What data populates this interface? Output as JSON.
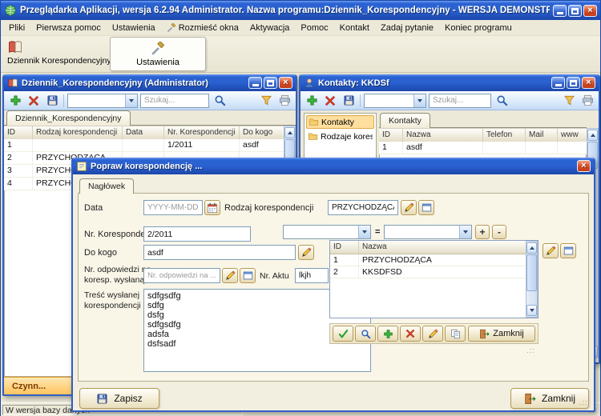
{
  "colors": {
    "titlebar_top": "#6a9af2",
    "titlebar_main": "#2b62d2",
    "titlebar_bottom": "#1c47ab",
    "close_button": "#da4f2a",
    "toolbar_blue": "#cfe2f7",
    "desktop_beige": "#ece9d8",
    "selection_orange": "#ffdf9e",
    "footer_orange": "#ffc45f",
    "button_border_tan": "#b59a57"
  },
  "icons": {
    "add": "green-plus",
    "delete": "red-x",
    "save": "floppy-disk",
    "search": "magnifier",
    "filter": "funnel",
    "print": "printer",
    "calendar": "calendar",
    "edit": "pencil",
    "lookup": "window",
    "accept": "green-check",
    "copy": "two-sheets",
    "exit": "door-arrow",
    "folder": "yellow-folder",
    "settings": "hammer-wrench",
    "journal": "red-book",
    "contacts": "person",
    "note": "note-sheet",
    "app": "green-globe"
  },
  "app": {
    "title": "Przeglądarka Aplikacji, wersja 6.2.94 Administrator. Nazwa programu:Dziennik_Korespondencyjny - WERSJA DEMONSTRAC...",
    "menu": [
      "Pliki",
      "Pierwsza pomoc",
      "Ustawienia",
      "Rozmieść okna",
      "Aktywacja",
      "Pomoc",
      "Kontakt",
      "Zadaj pytanie",
      "Koniec programu"
    ],
    "toolbar": {
      "journal": "Dziennik Korespondencyjny",
      "settings": "Ustawienia"
    },
    "status": "W wersja bazy danych"
  },
  "journal": {
    "title": "Dziennik_Korespondencyjny (Administrator)",
    "search_placeholder": "Szukaj...",
    "tab": "Dziennik_Korespondencyjny",
    "columns": [
      "ID",
      "Rodzaj korespondencji",
      "Data",
      "Nr. Korespondencji",
      "Do kogo"
    ],
    "rows": [
      [
        "1",
        "",
        "",
        "1/2011",
        "asdf"
      ],
      [
        "2",
        "PRZYCHODZĄCA",
        "",
        "",
        ""
      ],
      [
        "3",
        "PRZYCHODZĄCA",
        "",
        "",
        ""
      ],
      [
        "4",
        "PRZYCHODZĄCA",
        "",
        "",
        ""
      ]
    ],
    "footer": "Czynn..."
  },
  "contacts": {
    "title": "Kontakty: KKDSf",
    "search_placeholder": "Szukaj...",
    "tree": [
      "Kontakty",
      "Rodzaje korespondencji"
    ],
    "tab": "Kontakty",
    "columns": [
      "ID",
      "Nazwa",
      "Telefon",
      "Mail",
      "www"
    ],
    "rows": [
      [
        "1",
        "asdf",
        "",
        "",
        ""
      ]
    ]
  },
  "dialog": {
    "title": "Popraw  korespondencję ...",
    "tab": "Nagłówek",
    "data_label": "Data",
    "data_placeholder": "YYYY-MM-DD",
    "type_label": "Rodzaj korespondencji",
    "type_value": "PRZYCHODZĄCA",
    "nr_label": "Nr. Korespondencji",
    "nr_value": "2/2011",
    "to_label": "Do kogo",
    "to_value": "asdf",
    "reply_label": "Nr. odpowiedzi na koresp. wysłaną",
    "reply_placeholder": "Nr. odpowiedzi na ...",
    "act_label": "Nr. Aktu",
    "act_value": "lkjh",
    "body_label": "Treść wysłanej korespondencji",
    "body_value": "sdfgsdfg\nsdfg\ndsfg\nsdfgsdfg\nadsfa\ndsfsadf",
    "lookup": {
      "equals": "=",
      "add_label": "+",
      "remove_label": "-",
      "columns": [
        "ID",
        "Nazwa"
      ],
      "rows": [
        [
          "1",
          "PRZYCHODZĄCA"
        ],
        [
          "2",
          "KKSDFSD"
        ]
      ],
      "close_label": "Zamknij"
    },
    "save_label": "Zapisz",
    "close_label": "Zamknij"
  }
}
